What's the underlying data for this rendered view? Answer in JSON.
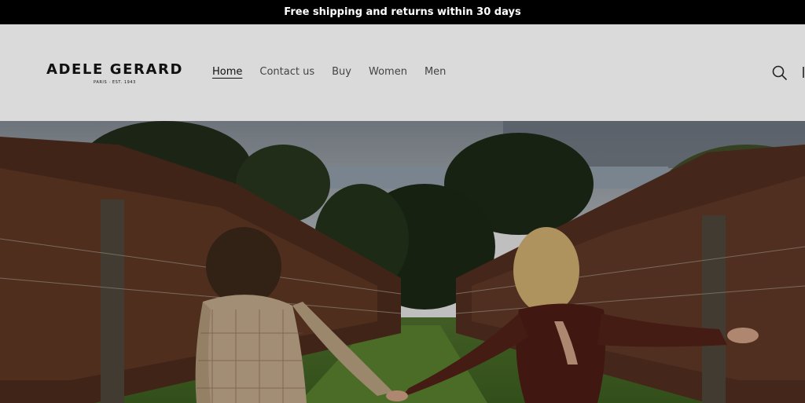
{
  "announcement": {
    "text": "Free shipping and returns within 30 days"
  },
  "brand": {
    "name": "ADELE GERARD",
    "tagline": "PARIS · EST. 1943"
  },
  "nav": {
    "items": [
      {
        "label": "Home",
        "active": true
      },
      {
        "label": "Contact us"
      },
      {
        "label": "Buy"
      },
      {
        "label": "Women"
      },
      {
        "label": "Men"
      }
    ]
  },
  "header_icons": {
    "search": "search-icon",
    "cart": "cart-icon"
  },
  "colors": {
    "announcement_bg": "#000000",
    "header_bg": "#dadada",
    "text": "#111111"
  }
}
